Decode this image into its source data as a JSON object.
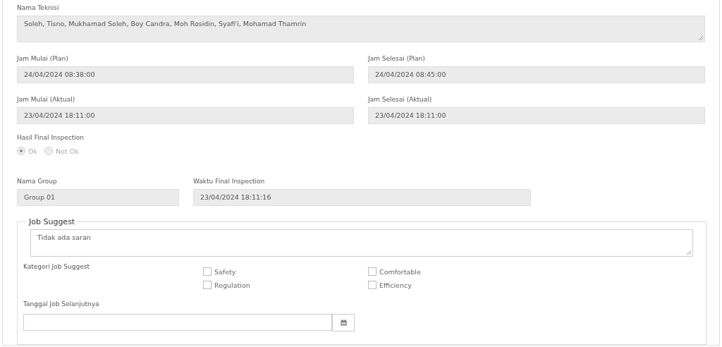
{
  "technicians": {
    "label": "Nama Teknisi",
    "value": "Soleh, Tisno, Mukhamad Soleh, Boy Candra, Moh Rosidin, Syafi'i, Mohamad Thamrin"
  },
  "time_fields": [
    {
      "label": "Jam Mulai (Plan)",
      "value": "24/04/2024 08:38:00"
    },
    {
      "label": "Jam Selesai (Plan)",
      "value": "24/04/2024 08:45:00"
    },
    {
      "label": "Jam Mulai (Aktual)",
      "value": "23/04/2024 18:11:00"
    },
    {
      "label": "Jam Selesai (Aktual)",
      "value": "23/04/2024 18:11:00"
    }
  ],
  "final_inspection": {
    "label": "Hasil Final Inspection",
    "options": [
      {
        "label": "Ok",
        "selected": true
      },
      {
        "label": "Not Ok",
        "selected": false
      }
    ]
  },
  "group": {
    "label": "Nama Group",
    "value": "Group 01"
  },
  "inspection_time": {
    "label": "Waktu Final Inspection",
    "value": "23/04/2024 18:11:16"
  },
  "job_suggest": {
    "legend": "Job Suggest",
    "value": "Tidak ada saran",
    "category_label": "Kategori Job Suggest",
    "categories": [
      {
        "label": "Safety",
        "checked": false
      },
      {
        "label": "Comfortable",
        "checked": false
      },
      {
        "label": "Regulation",
        "checked": false
      },
      {
        "label": "Efficiency",
        "checked": false
      }
    ],
    "next_date_label": "Tanggal Job Selanjutnya"
  }
}
